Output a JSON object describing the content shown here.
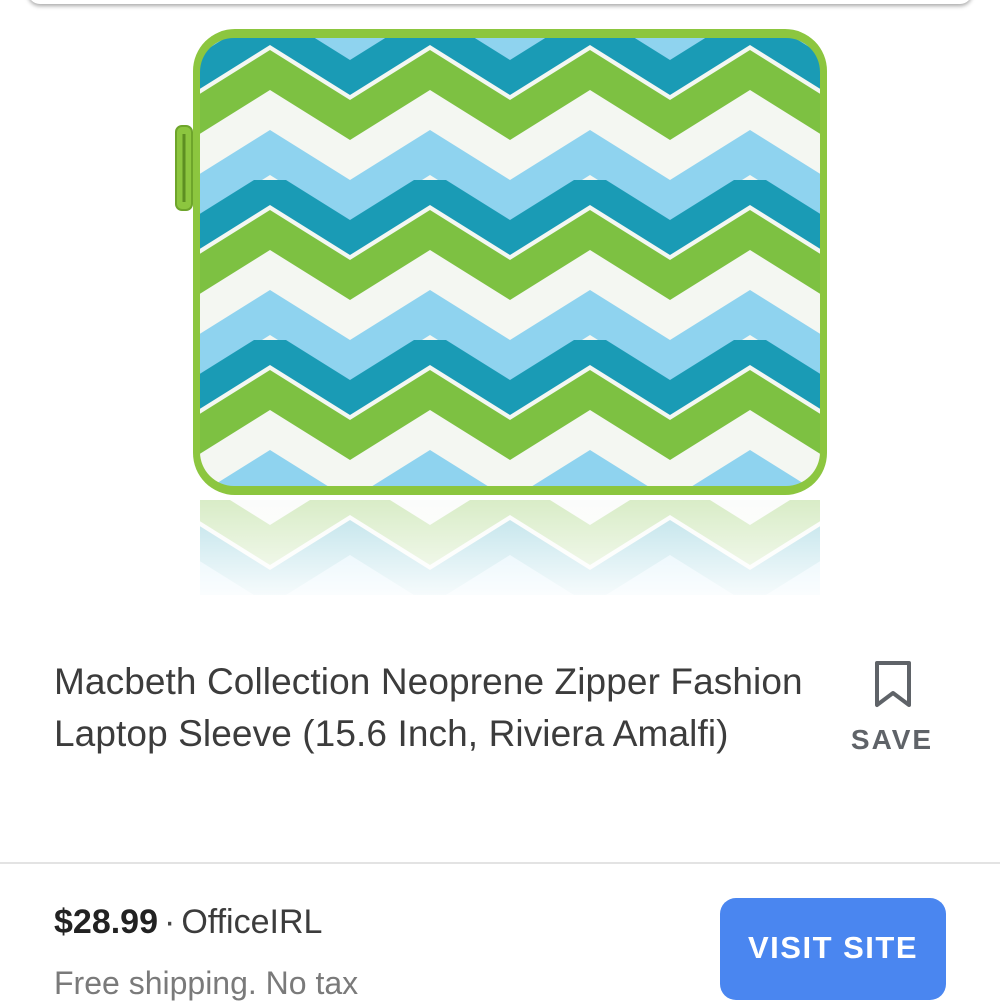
{
  "product": {
    "image_alt": "Laptop sleeve with blue and green chevron pattern",
    "title": "Macbeth Collection Neoprene Zipper Fashion Laptop Sleeve (15.6 Inch, Riviera Amalfi)",
    "save_label": "SAVE",
    "save_icon": "bookmark-icon"
  },
  "offer": {
    "price": "$28.99",
    "separator": "·",
    "merchant": "OfficeIRL",
    "shipping": "Free shipping. No tax",
    "visit_label": "VISIT SITE"
  },
  "colors": {
    "accent": "#4a86f0",
    "sleeve_trim": "#8cc63f",
    "pattern_green": "#7dc142",
    "pattern_teal": "#1a9bb5",
    "pattern_light_blue": "#8fd3ef",
    "pattern_white": "#f4f7f2"
  }
}
